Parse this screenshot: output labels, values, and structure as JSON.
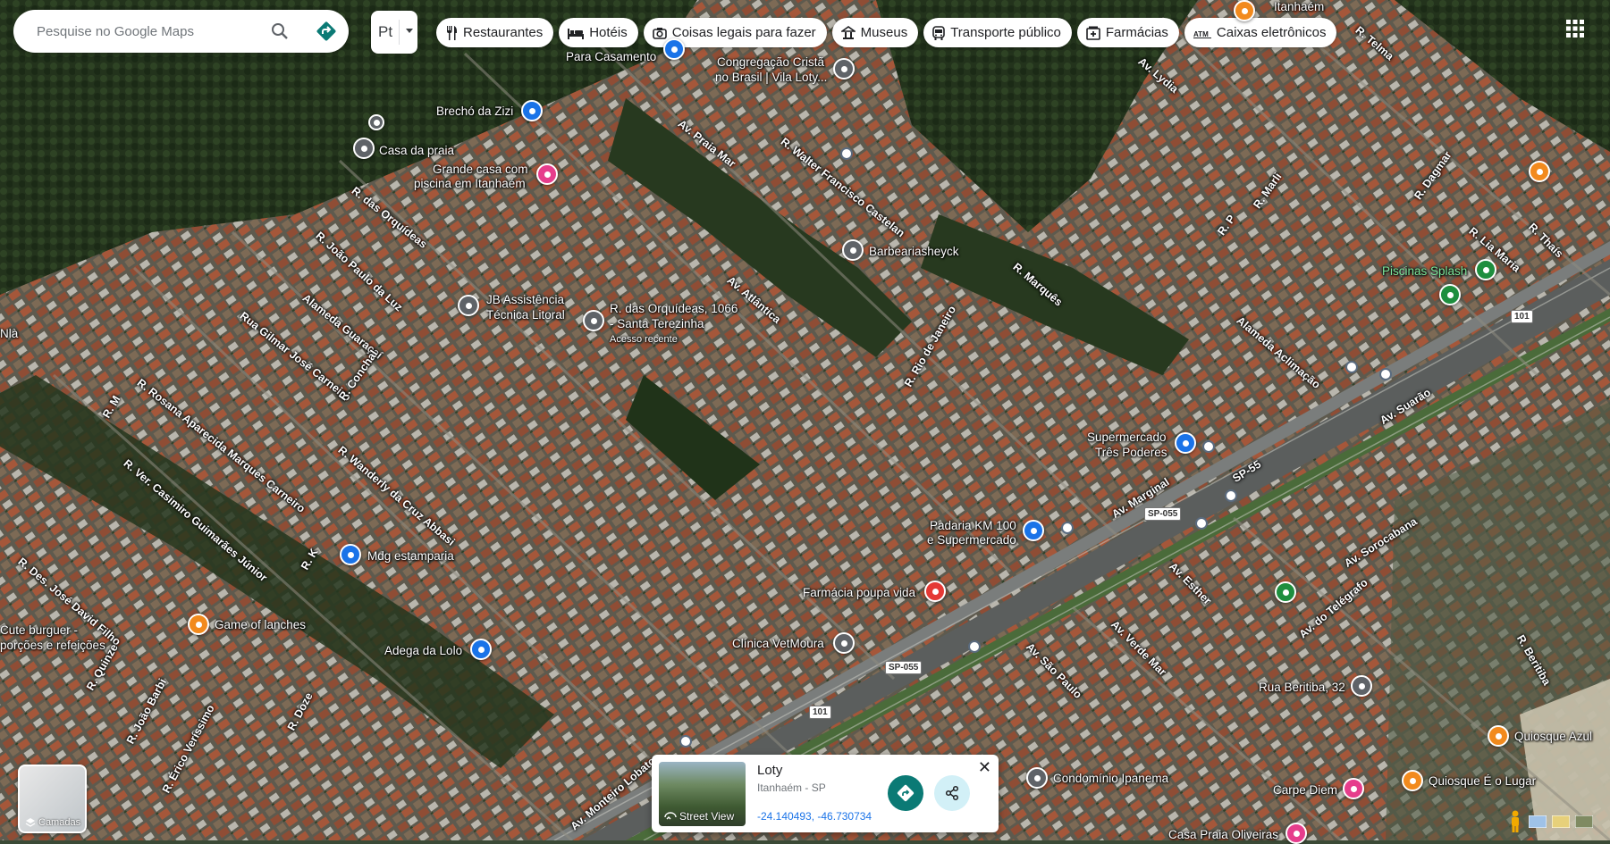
{
  "search": {
    "placeholder": "Pesquise no Google Maps"
  },
  "language": {
    "label": "Pt"
  },
  "chips": [
    {
      "label": "Restaurantes",
      "icon": "fork-knife-icon"
    },
    {
      "label": "Hotéis",
      "icon": "bed-icon"
    },
    {
      "label": "Coisas legais para fazer",
      "icon": "camera-icon"
    },
    {
      "label": "Museus",
      "icon": "museum-icon"
    },
    {
      "label": "Transporte público",
      "icon": "bus-icon"
    },
    {
      "label": "Farmácias",
      "icon": "pharmacy-icon"
    },
    {
      "label": "Caixas eletrônicos",
      "icon": "atm-icon"
    }
  ],
  "places": {
    "casamento": "Para Casamento",
    "congregacao_1": "Congregação Cristã",
    "congregacao_2": "no Brasil | Vila Loty...",
    "brecho": "Brechó da Zizi",
    "casa_praia": "Casa da praia",
    "grande_casa_1": "Grande casa com",
    "grande_casa_2": "piscina em Itanhaém",
    "barbearia": "Barbeariasheyck",
    "jb_1": "JB Assistência",
    "jb_2": "Técnica Litoral",
    "orquideas_1": "R. das Orquídeas, 1066",
    "orquideas_2": "- Santa Terezinha",
    "acesso_recente": "Acesso recente",
    "piscinas": "Piscinas Splash",
    "supermercado_1": "Supermercado",
    "supermercado_2": "Três Poderes",
    "padaria_1": "Padaria KM 100",
    "padaria_2": "e Supermercado",
    "farmacia": "Farmácia poupa vida",
    "mdg": "Mdg estamparia",
    "game": "Game of lanches",
    "cute_1": "Cute burguer -",
    "cute_2": "porções e refeições",
    "adega": "Adega da Lolo",
    "vetmoura": "Clínica VetMoura",
    "beritiba": "Rua Beritiba, 32",
    "quiosque_azul": "Quiosque Azul",
    "quiosque_lugar": "Quiosque É o Lugar",
    "condominio": "Condomínio Ipanema",
    "carpe": "Carpe Diem",
    "casa_oliveiras": "Casa Praia Oliveiras",
    "itanhaem": "Itanhaém",
    "nla": "Nlà"
  },
  "streets": [
    "R. das Orquídeas",
    "R. João Paulo da Luz",
    "Alameda Guaraçaí",
    "Rua Gilmar José Carneiro",
    "R. Conchal",
    "R. Rosana Aparecida Marques Carneiro",
    "R. Ver. Casimiro Guimarães Júnior",
    "R. Wanderly da Cruz Abbasi",
    "R. Des. José David Filho",
    "R. Quinze",
    "R. João Barbi",
    "R. Érico Veríssimo",
    "R. Doze",
    "R. K",
    "R. M",
    "Av. Praia Mar",
    "R. Walter Francisco Castelan",
    "Av. Atlântica",
    "R. Rio de Janeiro",
    "R. Marquês",
    "Av. Lydia",
    "R. Telma",
    "R. Dagmar",
    "R. Lia Maria",
    "R. Thaís",
    "Alameda Aclimação",
    "Av. Marginal",
    "SP-55",
    "Av. Suarão",
    "Av. Sorocabana",
    "Av. do Telégrafo",
    "Av. São Paulo",
    "Av. Verde Mar",
    "Av. Esther",
    "R. Beritiba",
    "Av. Monteiro Lobato",
    "R. Marli",
    "R. P"
  ],
  "shields": {
    "sp055": "SP-055",
    "r101": "101"
  },
  "card": {
    "title": "Loty",
    "subtitle": "Itanhaém - SP",
    "coords": "-24.140493, -46.730734",
    "street_view": "Street View"
  },
  "layers": {
    "label": "Camadas"
  },
  "colors": {
    "accent": "#0b7a75",
    "link": "#1a73e8",
    "hotel_pin": "#e63d8c",
    "shop_pin": "#1a73e8",
    "food_pin": "#f28a1d",
    "park_pin": "#1e8e3e",
    "pharmacy_pin": "#e53935",
    "generic_pin": "#5f6368"
  }
}
